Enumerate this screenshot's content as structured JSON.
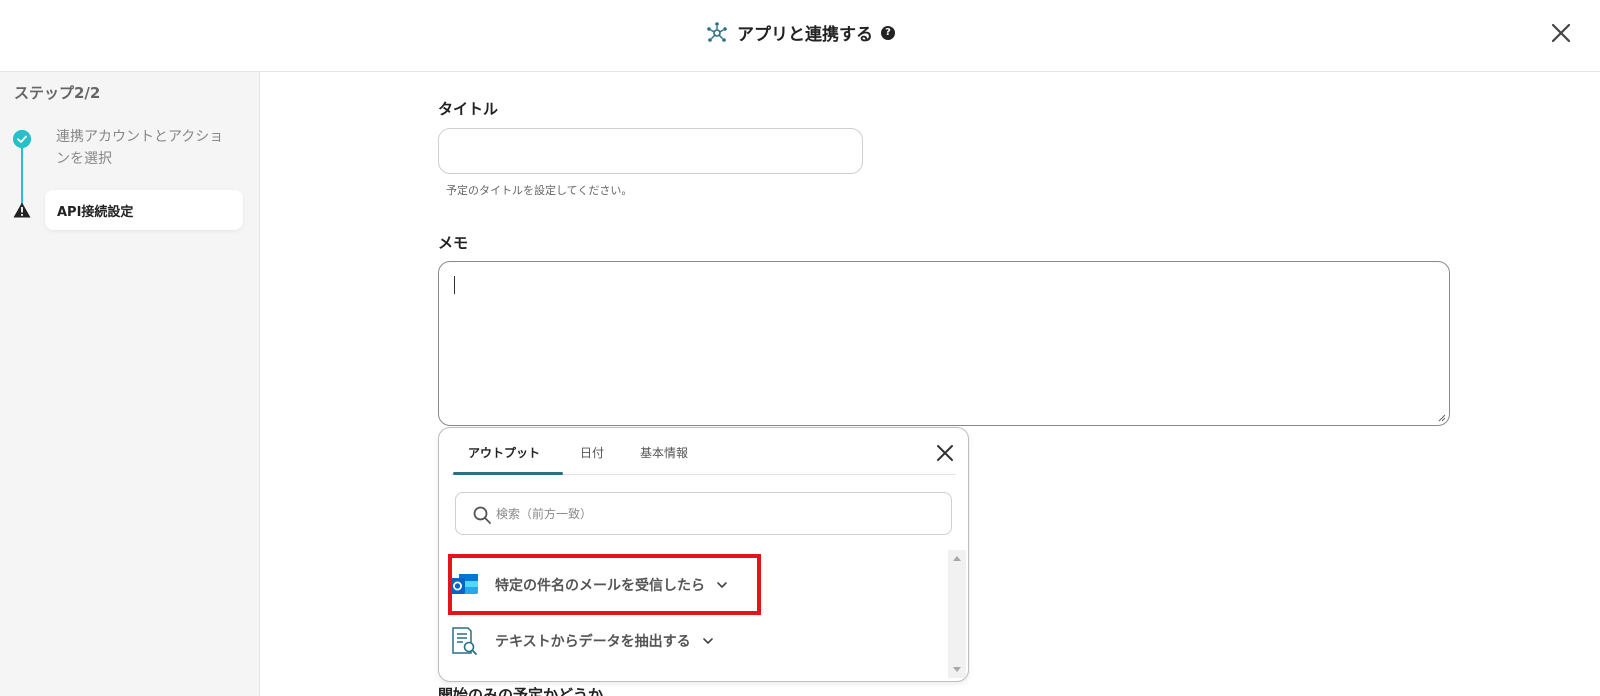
{
  "header": {
    "title": "アプリと連携する",
    "help_glyph": "?"
  },
  "sidebar": {
    "step_label": "ステップ2/2",
    "steps": [
      {
        "label": "連携アカウントとアクションを選択",
        "status": "done"
      },
      {
        "label": "API接続設定",
        "status": "warning"
      }
    ]
  },
  "form": {
    "title_label": "タイトル",
    "title_value": "",
    "title_hint": "予定のタイトルを設定してください。",
    "memo_label": "メモ",
    "memo_value": "",
    "next_label_partial": "開始のみの予定かどうか"
  },
  "popup": {
    "tabs": [
      {
        "label": "アウトプット",
        "active": true
      },
      {
        "label": "日付",
        "active": false
      },
      {
        "label": "基本情報",
        "active": false
      }
    ],
    "search_placeholder": "検索（前方一致）",
    "items": [
      {
        "label": "特定の件名のメールを受信したら",
        "icon": "outlook-icon",
        "highlighted": true
      },
      {
        "label": "テキストからデータを抽出する",
        "icon": "document-search-icon",
        "highlighted": false
      }
    ]
  },
  "colors": {
    "accent_teal": "#27bfc9",
    "tab_underline": "#2a6f86",
    "highlight_red": "#e3141c",
    "outlook_blue": "#0a64c4"
  }
}
